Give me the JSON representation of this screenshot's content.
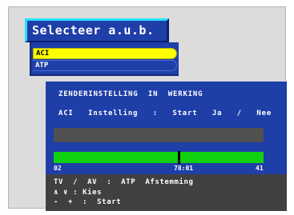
{
  "dialog": {
    "title": "Selecteer a.u.b."
  },
  "menu": {
    "items": [
      {
        "label": "ACI",
        "selected": true
      },
      {
        "label": "ATP",
        "selected": false
      }
    ]
  },
  "panel": {
    "status": "ZENDERINSTELLING  IN  WERKING",
    "prompt": "ACI  Instelling  :  Start  Ja  /  Nee"
  },
  "progress": {
    "fraction": 0.59,
    "min_label": "02",
    "current_label": "78:01",
    "max_label": "41"
  },
  "footer": {
    "line1": "TV  /  AV  :  ATP  Afstemming",
    "line2": "∧ ∨ : Kies",
    "line3": "-  +  :  Start"
  },
  "colors": {
    "panel": "#1e3ea8",
    "highlight": "#ffff00",
    "frame": "#26e0ff",
    "progress": "#10d010",
    "track": "#505050",
    "footer": "#404040"
  }
}
